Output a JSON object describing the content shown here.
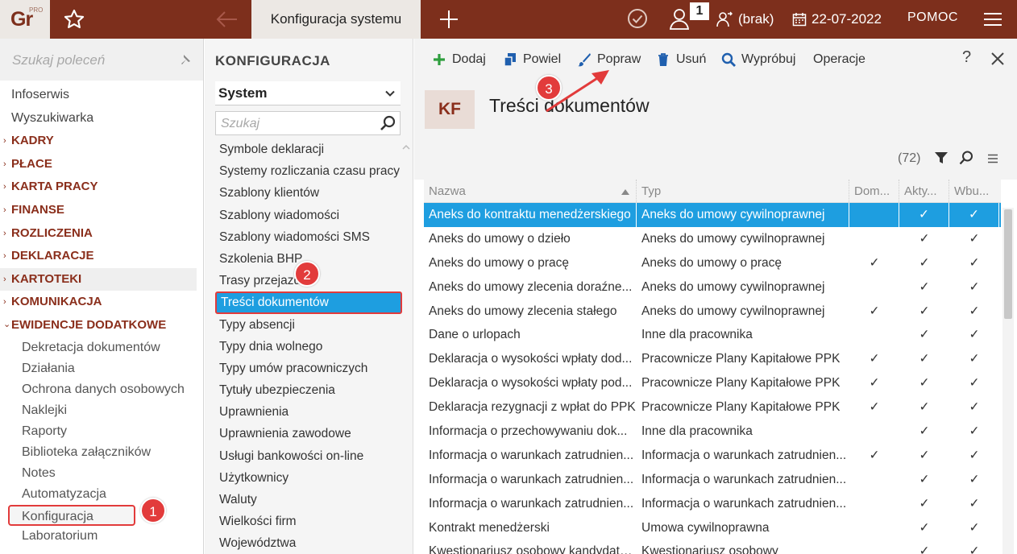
{
  "topbar": {
    "logo_text": "Gr",
    "logo_sup": "PRO",
    "active_tab": "Konfiguracja systemu",
    "badge_count": "1",
    "user_label": "(brak)",
    "date": "22-07-2022",
    "help_label": "POMOC"
  },
  "sidebar": {
    "search_placeholder": "Szukaj poleceń",
    "items": [
      {
        "label": "Infoserwis"
      },
      {
        "label": "Wyszukiwarka"
      },
      {
        "label": "KADRY"
      },
      {
        "label": "PŁACE"
      },
      {
        "label": "KARTA PRACY"
      },
      {
        "label": "FINANSE"
      },
      {
        "label": "ROZLICZENIA"
      },
      {
        "label": "DEKLARACJE"
      },
      {
        "label": "KARTOTEKI"
      },
      {
        "label": "KOMUNIKACJA"
      },
      {
        "label": "EWIDENCJE DODATKOWE"
      }
    ],
    "subitems": [
      {
        "label": "Dekretacja dokumentów"
      },
      {
        "label": "Działania"
      },
      {
        "label": "Ochrona danych osobowych"
      },
      {
        "label": "Naklejki"
      },
      {
        "label": "Raporty"
      },
      {
        "label": "Biblioteka załączników"
      },
      {
        "label": "Notes"
      },
      {
        "label": "Automatyzacja"
      },
      {
        "label": "Konfiguracja"
      },
      {
        "label": "Laboratorium"
      }
    ]
  },
  "middle": {
    "title": "KONFIGURACJA",
    "select_value": "System",
    "search_placeholder": "Szukaj",
    "items": [
      {
        "label": "Symbole deklaracji"
      },
      {
        "label": "Systemy rozliczania czasu pracy"
      },
      {
        "label": "Szablony klientów"
      },
      {
        "label": "Szablony wiadomości"
      },
      {
        "label": "Szablony wiadomości SMS"
      },
      {
        "label": "Szkolenia BHP"
      },
      {
        "label": "Trasy przejazdu"
      },
      {
        "label": "Treści dokumentów"
      },
      {
        "label": "Typy absencji"
      },
      {
        "label": "Typy dnia wolnego"
      },
      {
        "label": "Typy umów pracowniczych"
      },
      {
        "label": "Tytuły ubezpieczenia"
      },
      {
        "label": "Uprawnienia"
      },
      {
        "label": "Uprawnienia zawodowe"
      },
      {
        "label": "Usługi bankowości on-line"
      },
      {
        "label": "Użytkownicy"
      },
      {
        "label": "Waluty"
      },
      {
        "label": "Wielkości firm"
      },
      {
        "label": "Województwa"
      }
    ]
  },
  "toolbar": {
    "add": "Dodaj",
    "duplicate": "Powiel",
    "edit": "Popraw",
    "delete": "Usuń",
    "try": "Wypróbuj",
    "operations": "Operacje",
    "help": "?"
  },
  "document": {
    "badge": "KF",
    "title": "Treści dokumentów",
    "count": "(72)"
  },
  "table": {
    "columns": [
      "Nazwa",
      "Typ",
      "Dom...",
      "Akty...",
      "Wbu..."
    ],
    "check_glyph": "✓",
    "rows": [
      {
        "name": "Aneks do kontraktu menedżerskiego",
        "type": "Aneks do umowy cywilnoprawnej",
        "dom": "",
        "akt": "✓",
        "wbu": "✓"
      },
      {
        "name": "Aneks do umowy o dzieło",
        "type": "Aneks do umowy cywilnoprawnej",
        "dom": "",
        "akt": "✓",
        "wbu": "✓"
      },
      {
        "name": "Aneks do umowy o pracę",
        "type": "Aneks do umowy o pracę",
        "dom": "✓",
        "akt": "✓",
        "wbu": "✓"
      },
      {
        "name": "Aneks do umowy zlecenia doraźne...",
        "type": "Aneks do umowy cywilnoprawnej",
        "dom": "",
        "akt": "✓",
        "wbu": "✓"
      },
      {
        "name": "Aneks do umowy zlecenia stałego",
        "type": "Aneks do umowy cywilnoprawnej",
        "dom": "✓",
        "akt": "✓",
        "wbu": "✓"
      },
      {
        "name": "Dane o urlopach",
        "type": "Inne dla pracownika",
        "dom": "",
        "akt": "✓",
        "wbu": "✓"
      },
      {
        "name": "Deklaracja o wysokości wpłaty dod...",
        "type": "Pracownicze Plany Kapitałowe PPK",
        "dom": "✓",
        "akt": "✓",
        "wbu": "✓"
      },
      {
        "name": "Deklaracja o wysokości wpłaty pod...",
        "type": "Pracownicze Plany Kapitałowe PPK",
        "dom": "✓",
        "akt": "✓",
        "wbu": "✓"
      },
      {
        "name": "Deklaracja rezygnacji z wpłat do PPK",
        "type": "Pracownicze Plany Kapitałowe PPK",
        "dom": "✓",
        "akt": "✓",
        "wbu": "✓"
      },
      {
        "name": "Informacja o przechowywaniu dok...",
        "type": "Inne dla pracownika",
        "dom": "",
        "akt": "✓",
        "wbu": "✓"
      },
      {
        "name": "Informacja o warunkach zatrudnien...",
        "type": "Informacja o warunkach zatrudnien...",
        "dom": "✓",
        "akt": "✓",
        "wbu": "✓"
      },
      {
        "name": "Informacja o warunkach zatrudnien...",
        "type": "Informacja o warunkach zatrudnien...",
        "dom": "",
        "akt": "✓",
        "wbu": "✓"
      },
      {
        "name": "Informacja o warunkach zatrudnien...",
        "type": "Informacja o warunkach zatrudnien...",
        "dom": "",
        "akt": "✓",
        "wbu": "✓"
      },
      {
        "name": "Kontrakt menedżerski",
        "type": "Umowa cywilnoprawna",
        "dom": "",
        "akt": "✓",
        "wbu": "✓"
      },
      {
        "name": "Kwestionariusz osobowy kandydata...",
        "type": "Kwestionariusz osobowy",
        "dom": "",
        "akt": "✓",
        "wbu": "✓"
      }
    ]
  },
  "markers": {
    "m1": "1",
    "m2": "2",
    "m3": "3"
  },
  "colors": {
    "brand": "#7d2f1c",
    "selection": "#1e9ee0",
    "marker": "#e23b3b"
  }
}
